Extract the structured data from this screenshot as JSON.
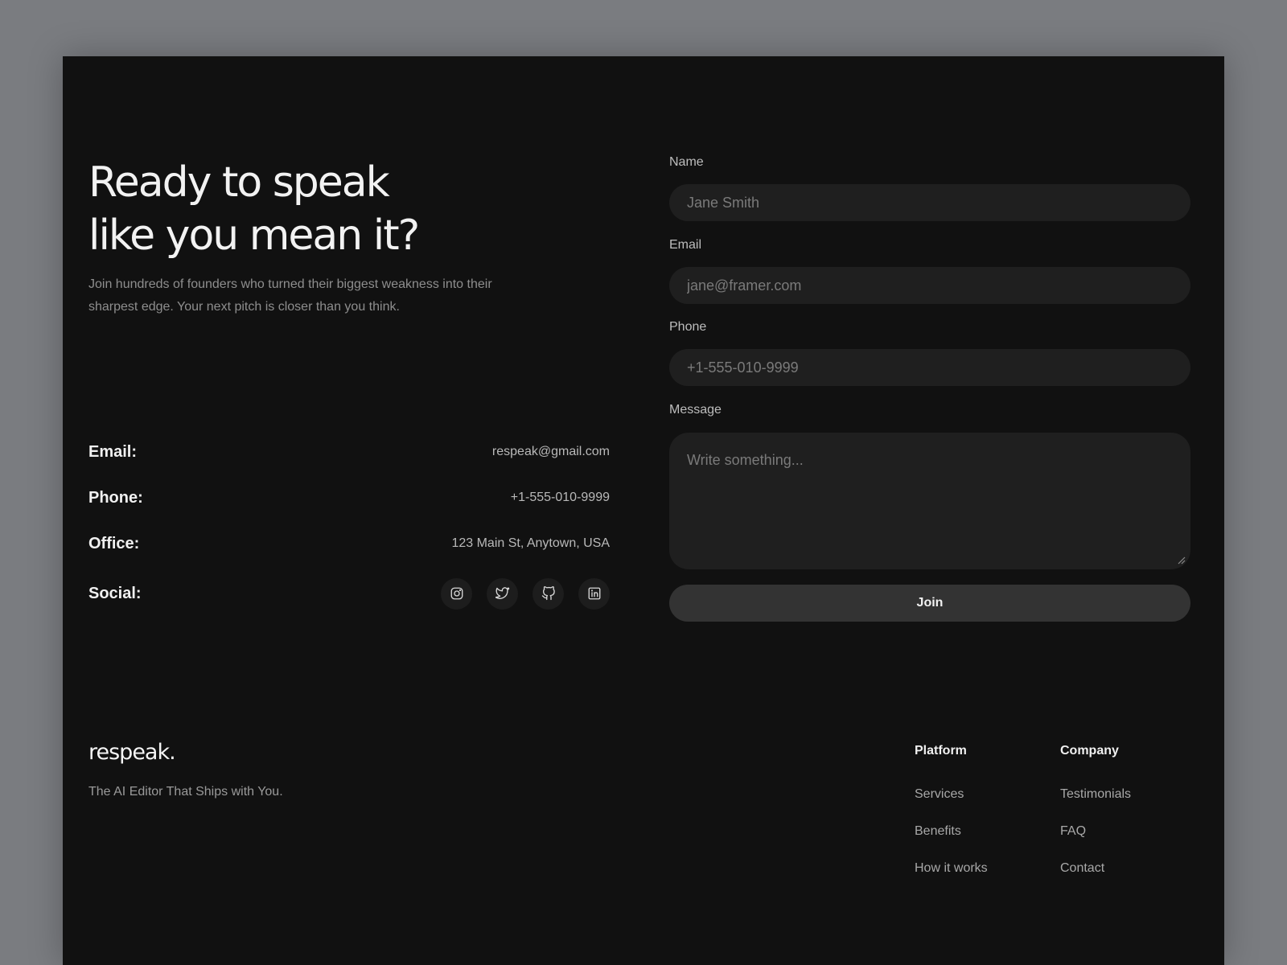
{
  "hero": {
    "headline_line1": "Ready to speak",
    "headline_line2": "like you mean it?",
    "subtext": "Join hundreds of founders who turned their biggest weakness into their sharpest edge. Your next pitch is closer than you think."
  },
  "contact": {
    "email_label": "Email:",
    "email_value": "respeak@gmail.com",
    "phone_label": "Phone:",
    "phone_value": "+1-555-010-9999",
    "office_label": "Office:",
    "office_value": "123 Main St, Anytown, USA",
    "social_label": "Social:",
    "social_icons": [
      "instagram-icon",
      "twitter-icon",
      "github-icon",
      "linkedin-icon"
    ]
  },
  "form": {
    "name_label": "Name",
    "name_placeholder": "Jane Smith",
    "email_label": "Email",
    "email_placeholder": "jane@framer.com",
    "phone_label": "Phone",
    "phone_placeholder": "+1-555-010-9999",
    "message_label": "Message",
    "message_placeholder": "Write something...",
    "submit_label": "Join"
  },
  "footer": {
    "logo": "respeak.",
    "tagline": "The AI Editor That Ships with You.",
    "columns": [
      {
        "heading": "Platform",
        "links": [
          "Services",
          "Benefits",
          "How it works"
        ]
      },
      {
        "heading": "Company",
        "links": [
          "Testimonials",
          "FAQ",
          "Contact"
        ]
      }
    ]
  },
  "colors": {
    "page_background": "#7a7c80",
    "card_background": "#111111",
    "input_background": "#1f1f1f",
    "button_background": "#333333",
    "text_primary": "#f2f2f2",
    "text_muted": "#8e8e8e"
  }
}
